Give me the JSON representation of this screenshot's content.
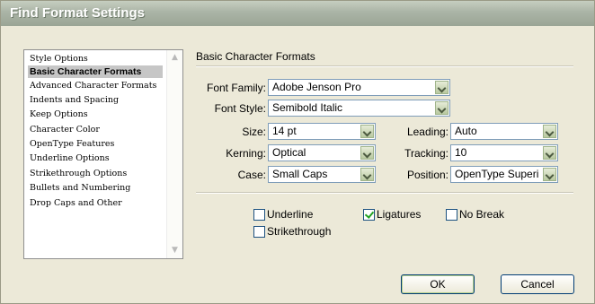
{
  "window": {
    "title": "Find Format Settings"
  },
  "sidebar": {
    "items": [
      {
        "label": "Style Options",
        "selected": false
      },
      {
        "label": "Basic Character Formats",
        "selected": true
      },
      {
        "label": "Advanced Character Formats",
        "selected": false
      },
      {
        "label": "Indents and Spacing",
        "selected": false
      },
      {
        "label": "Keep Options",
        "selected": false
      },
      {
        "label": "Character Color",
        "selected": false
      },
      {
        "label": "OpenType Features",
        "selected": false
      },
      {
        "label": "Underline Options",
        "selected": false
      },
      {
        "label": "Strikethrough Options",
        "selected": false
      },
      {
        "label": "Bullets and Numbering",
        "selected": false
      },
      {
        "label": "Drop Caps and Other",
        "selected": false
      }
    ]
  },
  "main": {
    "section_title": "Basic Character Formats",
    "fields": {
      "font_family": {
        "label": "Font Family:",
        "value": "Adobe Jenson Pro"
      },
      "font_style": {
        "label": "Font Style:",
        "value": "Semibold Italic"
      },
      "size": {
        "label": "Size:",
        "value": "14 pt"
      },
      "leading": {
        "label": "Leading:",
        "value": "Auto"
      },
      "kerning": {
        "label": "Kerning:",
        "value": "Optical"
      },
      "tracking": {
        "label": "Tracking:",
        "value": "10"
      },
      "case": {
        "label": "Case:",
        "value": "Small Caps"
      },
      "position": {
        "label": "Position:",
        "value": "OpenType Superi"
      }
    },
    "checkboxes": {
      "underline": {
        "label": "Underline",
        "checked": false
      },
      "ligatures": {
        "label": "Ligatures",
        "checked": true
      },
      "no_break": {
        "label": "No Break",
        "checked": false
      },
      "strikethrough": {
        "label": "Strikethrough",
        "checked": false
      }
    }
  },
  "buttons": {
    "ok": "OK",
    "cancel": "Cancel"
  },
  "colors": {
    "selection": "#c6c6c6",
    "face": "#ECE9D8",
    "border": "#7f9db9"
  },
  "icons": {
    "dropdown": "chevron-down-icon",
    "scroll_up": "arrow-up-icon",
    "scroll_down": "arrow-down-icon"
  }
}
